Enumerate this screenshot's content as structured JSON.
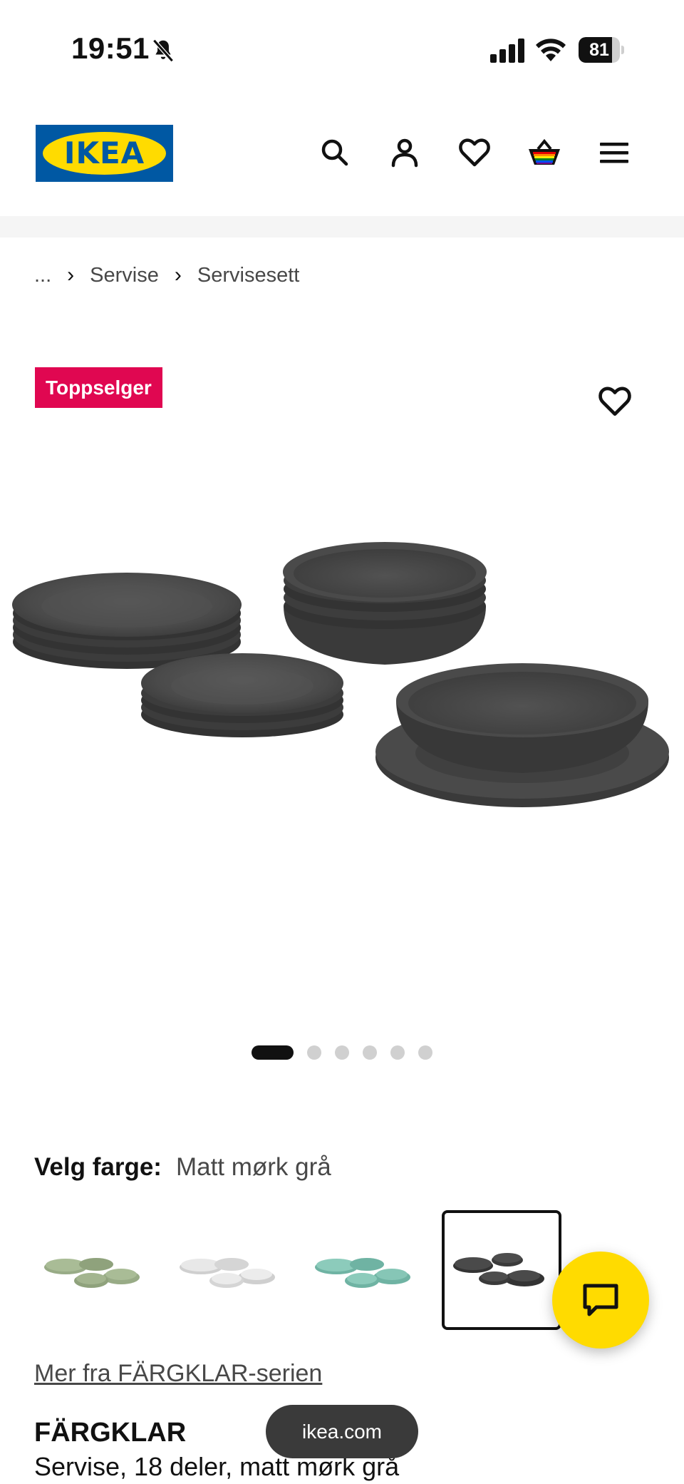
{
  "status_bar": {
    "time": "19:51",
    "battery": "81",
    "battery_level": 0.81
  },
  "header": {
    "logo": "IKEA",
    "icons": [
      "search-icon",
      "account-icon",
      "heart-icon",
      "shopping-bag-icon",
      "menu-icon"
    ]
  },
  "breadcrumb": {
    "ellipsis": "...",
    "items": [
      "Servise",
      "Servisesett"
    ]
  },
  "badge": "Toppselger",
  "carousel": {
    "count": 6,
    "active": 0
  },
  "color_select": {
    "label": "Velg farge:",
    "value": "Matt mørk grå",
    "swatches": [
      "sage-green",
      "white",
      "light-turquoise",
      "dark-grey"
    ],
    "selected_index": 3
  },
  "series_link": "Mer fra FÄRGKLAR-serien",
  "product": {
    "name": "FÄRGKLAR",
    "description": "Servise, 18 deler, matt mørk grå"
  },
  "url_pill": "ikea.com",
  "colors": {
    "ikea_blue": "#0058a3",
    "ikea_yellow": "#ffdb00",
    "badge_red": "#e00751"
  }
}
